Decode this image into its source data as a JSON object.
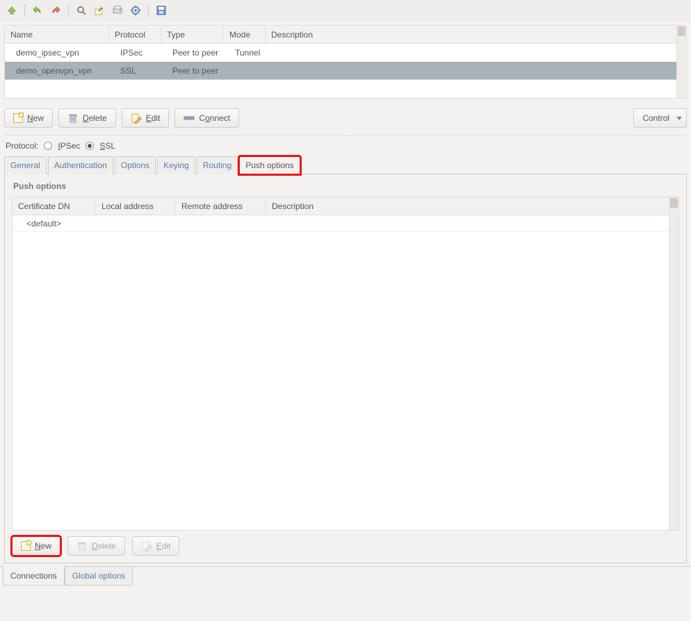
{
  "toolbar_icons": [
    "up",
    "undo",
    "redo",
    "find",
    "export",
    "print",
    "settings",
    "save"
  ],
  "grid": {
    "headers": {
      "name": "Name",
      "protocol": "Protocol",
      "type": "Type",
      "mode": "Mode",
      "description": "Description"
    },
    "rows": [
      {
        "name": "demo_ipsec_vpn",
        "protocol": "IPSec",
        "type": "Peer to peer",
        "mode": "Tunnel",
        "description": "",
        "selected": false
      },
      {
        "name": "demo_openvpn_vpn",
        "protocol": "SSL",
        "type": "Peer to peer",
        "mode": "",
        "description": "",
        "selected": true
      }
    ]
  },
  "buttons": {
    "new": "New",
    "delete": "Delete",
    "edit": "Edit",
    "connect": "Connect",
    "control": "Control"
  },
  "protocol_label": "Protocol:",
  "protocol_options": {
    "ipsec": "IPSec",
    "ssl": "SSL"
  },
  "protocol_selected": "ssl",
  "tabs": [
    "General",
    "Authentication",
    "Options",
    "Keying",
    "Routing",
    "Push options"
  ],
  "active_tab": "Push options",
  "push": {
    "title": "Push options",
    "headers": {
      "cert": "Certificate DN",
      "local": "Local address",
      "remote": "Remote address",
      "desc": "Description"
    },
    "rows": [
      {
        "cert": "<default>",
        "local": "",
        "remote": "",
        "desc": ""
      }
    ],
    "buttons": {
      "new": "New",
      "delete": "Delete",
      "edit": "Edit"
    }
  },
  "bottom_tabs": {
    "connections": "Connections",
    "global": "Global options",
    "active": "connections"
  }
}
